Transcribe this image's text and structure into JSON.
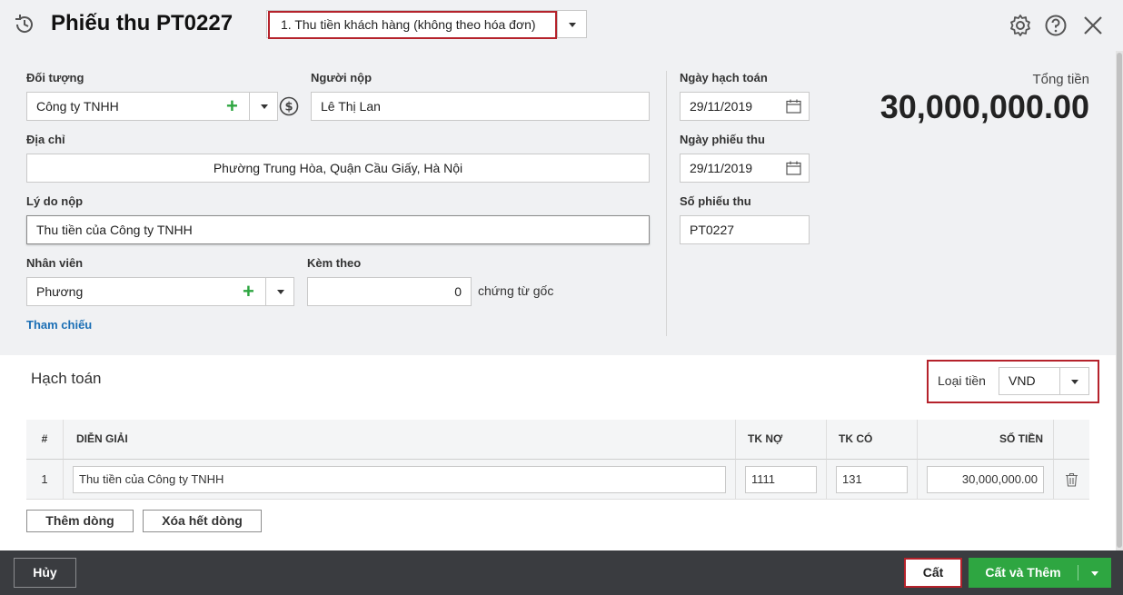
{
  "header": {
    "title": "Phiếu thu PT0227",
    "voucher_type": "1. Thu tiền khách hàng (không theo hóa đơn)"
  },
  "form": {
    "object_label": "Đối tượng",
    "object_value": "Công ty TNHH",
    "payer_label": "Người nộp",
    "payer_value": "Lê Thị Lan",
    "address_label": "Địa chỉ",
    "address_value": "Phường Trung Hòa, Quận Cầu Giấy, Hà Nội",
    "reason_label": "Lý do nộp",
    "reason_value": "Thu tiền của Công ty TNHH",
    "employee_label": "Nhân viên",
    "employee_value": "Phương",
    "attach_label": "Kèm theo",
    "attach_value": "0",
    "attach_suffix": "chứng từ gốc",
    "reference_link": "Tham chiếu",
    "posting_date_label": "Ngày hạch toán",
    "posting_date_value": "29/11/2019",
    "receipt_date_label": "Ngày phiếu thu",
    "receipt_date_value": "29/11/2019",
    "receipt_no_label": "Số phiếu thu",
    "receipt_no_value": "PT0227",
    "total_label": "Tổng tiền",
    "total_value": "30,000,000.00"
  },
  "accounting": {
    "title": "Hạch toán",
    "currency_label": "Loại tiền",
    "currency_value": "VND",
    "columns": [
      "#",
      "DIỄN GIẢI",
      "TK NỢ",
      "TK CÓ",
      "SỐ TIỀN"
    ],
    "rows": [
      {
        "no": "1",
        "description": "Thu tiền của Công ty TNHH",
        "debit": "1111",
        "credit": "131",
        "amount": "30,000,000.00"
      }
    ],
    "add_row_label": "Thêm dòng",
    "clear_rows_label": "Xóa hết dòng"
  },
  "footer": {
    "cancel_label": "Hủy",
    "save_label": "Cất",
    "save_add_label": "Cất và Thêm"
  },
  "colors": {
    "highlight_border": "#b5222b",
    "primary_green": "#2ea641",
    "footer_bg": "#3a3c40",
    "link_blue": "#1b6fb5"
  },
  "icons": [
    "history-icon",
    "settings-icon",
    "help-icon",
    "close-icon",
    "plus-icon",
    "dollar-icon",
    "calendar-icon",
    "trash-icon",
    "chevron-down-icon"
  ]
}
